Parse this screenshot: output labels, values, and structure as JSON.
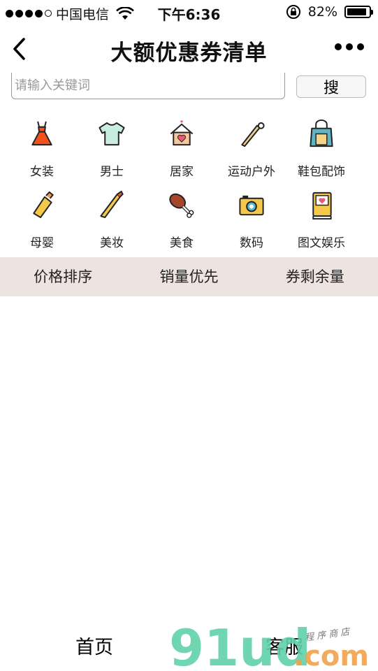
{
  "status_bar": {
    "carrier": "中国电信",
    "time": "下午6:36",
    "battery": "82%",
    "battery_level": 0.82
  },
  "nav": {
    "title": "大额优惠券清单"
  },
  "search": {
    "placeholder": "请输入关键词",
    "button_label": "搜"
  },
  "categories": [
    {
      "label": "女装",
      "icon": "dress-icon"
    },
    {
      "label": "男士",
      "icon": "tshirt-icon"
    },
    {
      "label": "居家",
      "icon": "house-icon"
    },
    {
      "label": "运动户外",
      "icon": "baseball-bat-icon"
    },
    {
      "label": "鞋包配饰",
      "icon": "bag-icon"
    },
    {
      "label": "母婴",
      "icon": "baby-bottle-icon"
    },
    {
      "label": "美妆",
      "icon": "lipstick-icon"
    },
    {
      "label": "美食",
      "icon": "drumstick-icon"
    },
    {
      "label": "数码",
      "icon": "camera-icon"
    },
    {
      "label": "图文娱乐",
      "icon": "book-icon"
    }
  ],
  "sort_tabs": [
    "价格排序",
    "销量优先",
    "券剩余量"
  ],
  "tab_bar": {
    "home": "首页",
    "service": "客服"
  },
  "watermark": {
    "brand": "91ud",
    "domain": ".com",
    "tagline": "程序商店"
  },
  "colors": {
    "sort_bar_bg": "#ede4e2",
    "watermark_green": "#5fd1a8",
    "watermark_orange": "#f1a14a"
  }
}
